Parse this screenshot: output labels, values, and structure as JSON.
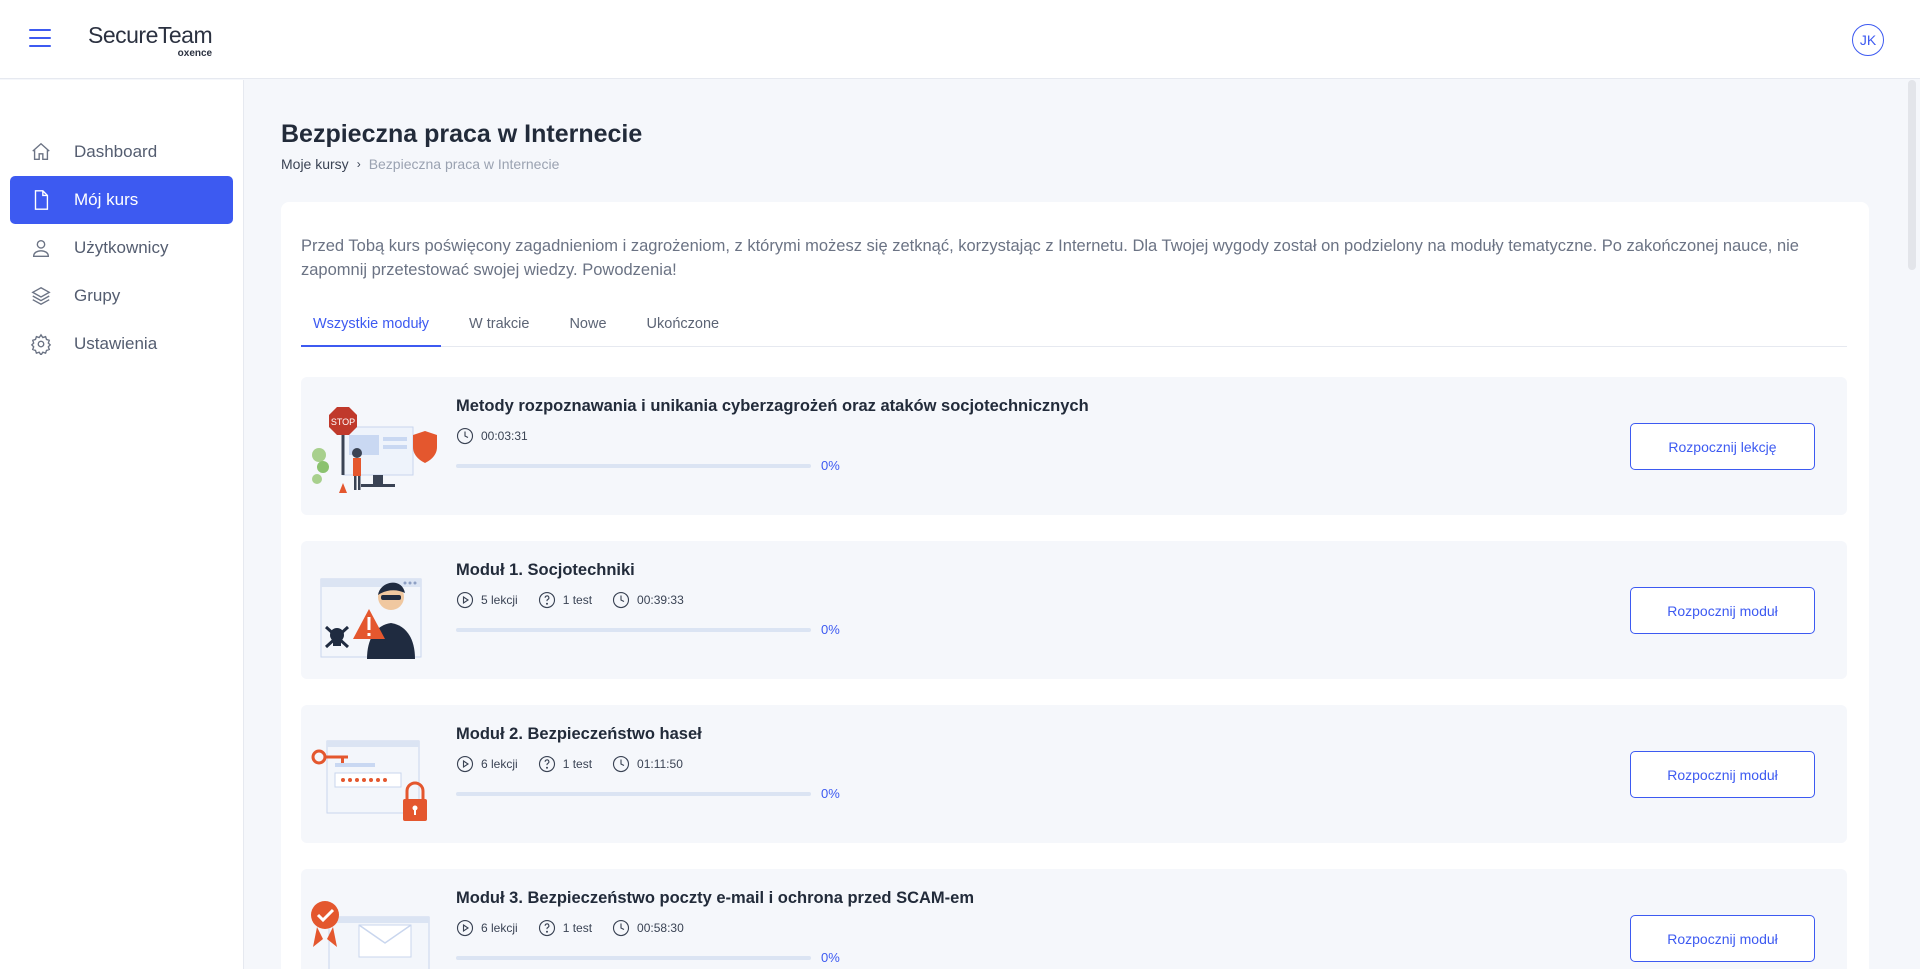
{
  "header": {
    "logo_main": "SecureTeam",
    "logo_sub": "oxence",
    "avatar": "JK"
  },
  "sidebar": {
    "items": [
      {
        "label": "Dashboard",
        "icon": "home-icon"
      },
      {
        "label": "Mój kurs",
        "icon": "document-icon",
        "active": true
      },
      {
        "label": "Użytkownicy",
        "icon": "user-icon"
      },
      {
        "label": "Grupy",
        "icon": "layers-icon"
      },
      {
        "label": "Ustawienia",
        "icon": "gear-icon"
      }
    ]
  },
  "page": {
    "title": "Bezpieczna praca w Internecie",
    "breadcrumb": {
      "link": "Moje kursy",
      "current": "Bezpieczna praca w Internecie"
    },
    "intro": "Przed Tobą kurs poświęcony zagadnieniom i zagrożeniom, z którymi możesz się zetknąć, korzystając z Internetu. Dla Twojej wygody został on podzielony na moduły tematyczne. Po zakończonej nauce, nie zapomnij przetestować swojej wiedzy. Powodzenia!"
  },
  "tabs": [
    "Wszystkie moduły",
    "W trakcie",
    "Nowe",
    "Ukończone"
  ],
  "modules": [
    {
      "title": "Metody rozpoznawania i unikania cyberzagrożeń oraz ataków socjotechnicznych",
      "duration": "00:03:31",
      "progress": "0%",
      "progress_value": 0,
      "button": "Rozpocznij lekcję",
      "image_text": "STOP"
    },
    {
      "title": "Moduł 1. Socjotechniki",
      "lessons": "5 lekcji",
      "tests": "1 test",
      "duration": "00:39:33",
      "progress": "0%",
      "progress_value": 0,
      "button": "Rozpocznij moduł"
    },
    {
      "title": "Moduł 2. Bezpieczeństwo haseł",
      "lessons": "6 lekcji",
      "tests": "1 test",
      "duration": "01:11:50",
      "progress": "0%",
      "progress_value": 0,
      "button": "Rozpocznij moduł"
    },
    {
      "title": "Moduł 3. Bezpieczeństwo poczty e-mail i ochrona przed SCAM-em",
      "lessons": "6 lekcji",
      "tests": "1 test",
      "duration": "00:58:30",
      "progress": "0%",
      "progress_value": 0,
      "button": "Rozpocznij moduł"
    }
  ],
  "colors": {
    "accent": "#3d5af1",
    "muted": "#9aa2b1",
    "background": "#f5f7fb"
  }
}
